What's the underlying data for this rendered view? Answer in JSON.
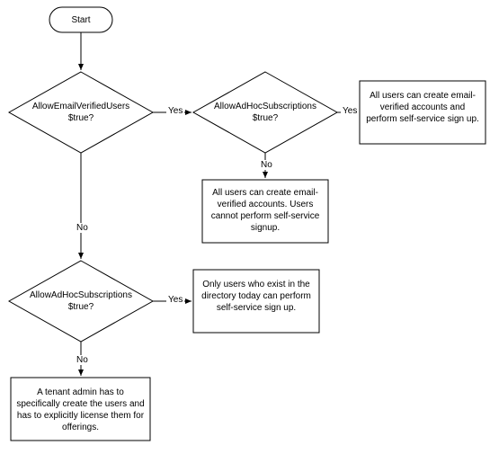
{
  "chart_data": {
    "type": "flowchart",
    "nodes": [
      {
        "id": "start",
        "shape": "rounded",
        "label": "Start"
      },
      {
        "id": "d1",
        "shape": "diamond",
        "label": "AllowEmailVerifiedUsers $true?"
      },
      {
        "id": "d2",
        "shape": "diamond",
        "label": "AllowAdHocSubscriptions $true?"
      },
      {
        "id": "r1",
        "shape": "rect",
        "label": "All users can create email-verified accounts and perform self-service sign up."
      },
      {
        "id": "r2",
        "shape": "rect",
        "label": "All users can create email-verified accounts. Users cannot perform self-service signup."
      },
      {
        "id": "d3",
        "shape": "diamond",
        "label": "AllowAdHocSubscriptions $true?"
      },
      {
        "id": "r3",
        "shape": "rect",
        "label": "Only users who exist in the directory today can perform self-service sign up."
      },
      {
        "id": "r4",
        "shape": "rect",
        "label": "A tenant admin has to specifically create the users and has to explicitly license them for offerings."
      }
    ],
    "edges": [
      {
        "from": "start",
        "to": "d1"
      },
      {
        "from": "d1",
        "to": "d2",
        "label": "Yes"
      },
      {
        "from": "d2",
        "to": "r1",
        "label": "Yes"
      },
      {
        "from": "d2",
        "to": "r2",
        "label": "No"
      },
      {
        "from": "d1",
        "to": "d3",
        "label": "No"
      },
      {
        "from": "d3",
        "to": "r3",
        "label": "Yes"
      },
      {
        "from": "d3",
        "to": "r4",
        "label": "No"
      }
    ]
  },
  "labels": {
    "start": "Start",
    "d1_l1": "AllowEmailVerifiedUsers",
    "d1_l2": "$true?",
    "d2_l1": "AllowAdHocSubscriptions",
    "d2_l2": "$true?",
    "r1": "All users can create email-verified accounts and perform self-service sign up.",
    "r2": "All users can create email-verified accounts. Users cannot perform self-service signup.",
    "d3_l1": "AllowAdHocSubscriptions",
    "d3_l2": "$true?",
    "r3": "Only users who exist in the directory today can perform self-service sign up.",
    "r4": "A tenant admin has to specifically create the users and has to explicitly license them for offerings.",
    "yes": "Yes",
    "no": "No"
  }
}
